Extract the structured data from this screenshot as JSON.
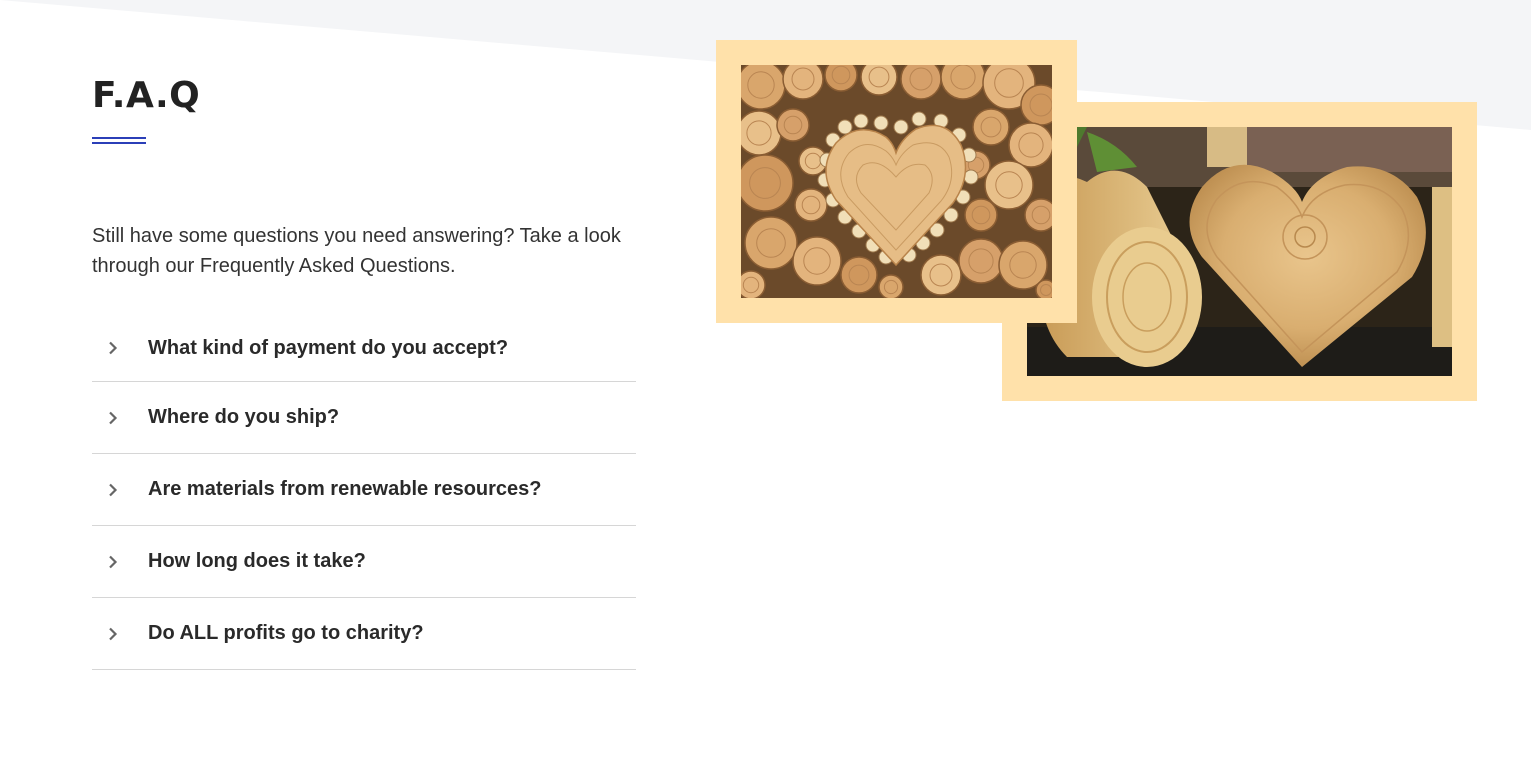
{
  "colors": {
    "accent": "#2b3fb8",
    "frame": "#ffe1aa",
    "background_band": "#f4f5f7",
    "divider": "#d6d6d6"
  },
  "faq": {
    "title": "F.A.Q",
    "intro": "Still have some questions you need answering? Take a look through our Frequently Asked Questions.",
    "items": [
      {
        "question": "What kind of payment do you accept?",
        "icon": "chevron-right-icon"
      },
      {
        "question": "Where do you ship?",
        "icon": "chevron-right-icon"
      },
      {
        "question": "Are materials from renewable resources?",
        "icon": "chevron-right-icon"
      },
      {
        "question": "How long does it take?",
        "icon": "chevron-right-icon"
      },
      {
        "question": "Do ALL profits go to charity?",
        "icon": "chevron-right-icon"
      }
    ]
  },
  "images": [
    {
      "subject": "stacked-logs-heart"
    },
    {
      "subject": "wooden-hearts"
    }
  ]
}
